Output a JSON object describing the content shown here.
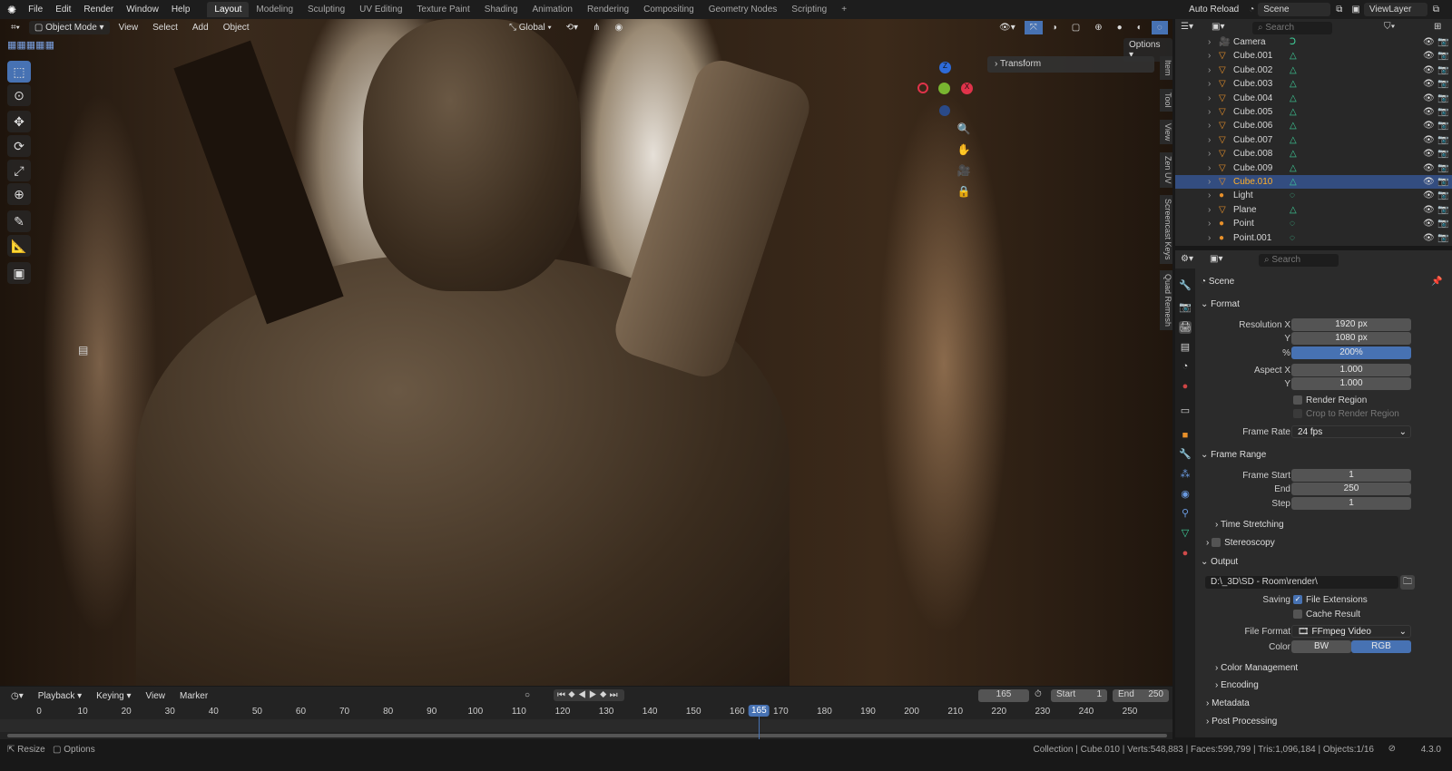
{
  "menu": [
    "File",
    "Edit",
    "Render",
    "Window",
    "Help"
  ],
  "workspaces": [
    "Layout",
    "Modeling",
    "Sculpting",
    "UV Editing",
    "Texture Paint",
    "Shading",
    "Animation",
    "Rendering",
    "Compositing",
    "Geometry Nodes",
    "Scripting"
  ],
  "topright": {
    "auto_reload": "Auto Reload",
    "scene": "Scene",
    "view_layer": "ViewLayer"
  },
  "viewport_header": {
    "mode": "Object Mode",
    "menus": [
      "View",
      "Select",
      "Add",
      "Object"
    ],
    "orientation": "Global",
    "options": "Options"
  },
  "npanel": {
    "transform": "Transform",
    "tabs": [
      "Item",
      "Tool",
      "View",
      "Zen UV",
      "Screencast Keys",
      "Quad Remesh"
    ]
  },
  "gizmo": {
    "z": "Z",
    "x": "X"
  },
  "outliner": {
    "search_placeholder": "Search",
    "items": [
      {
        "name": "Camera",
        "type": "camera"
      },
      {
        "name": "Cube.001",
        "type": "mesh"
      },
      {
        "name": "Cube.002",
        "type": "mesh"
      },
      {
        "name": "Cube.003",
        "type": "mesh"
      },
      {
        "name": "Cube.004",
        "type": "mesh"
      },
      {
        "name": "Cube.005",
        "type": "mesh"
      },
      {
        "name": "Cube.006",
        "type": "mesh"
      },
      {
        "name": "Cube.007",
        "type": "mesh"
      },
      {
        "name": "Cube.008",
        "type": "mesh"
      },
      {
        "name": "Cube.009",
        "type": "mesh"
      },
      {
        "name": "Cube.010",
        "type": "mesh",
        "selected": true
      },
      {
        "name": "Light",
        "type": "light"
      },
      {
        "name": "Plane",
        "type": "mesh"
      },
      {
        "name": "Point",
        "type": "light"
      },
      {
        "name": "Point.001",
        "type": "light"
      }
    ]
  },
  "properties": {
    "search_placeholder": "Search",
    "context": "Scene",
    "format": {
      "title": "Format",
      "res_x_label": "Resolution X",
      "res_x": "1920 px",
      "res_y_label": "Y",
      "res_y": "1080 px",
      "pct_label": "%",
      "pct": "200%",
      "aspect_x_label": "Aspect X",
      "aspect_x": "1.000",
      "aspect_y_label": "Y",
      "aspect_y": "1.000",
      "render_region": "Render Region",
      "crop": "Crop to Render Region",
      "frame_rate_label": "Frame Rate",
      "frame_rate": "24 fps"
    },
    "frame_range": {
      "title": "Frame Range",
      "start_label": "Frame Start",
      "start": "1",
      "end_label": "End",
      "end": "250",
      "step_label": "Step",
      "step": "1",
      "time_stretching": "Time Stretching"
    },
    "stereoscopy": "Stereoscopy",
    "output": {
      "title": "Output",
      "path": "D:\\_3D\\SD - Room\\render\\",
      "saving_label": "Saving",
      "file_ext": "File Extensions",
      "cache": "Cache Result",
      "format_label": "File Format",
      "format": "FFmpeg Video",
      "color_label": "Color",
      "bw": "BW",
      "rgb": "RGB",
      "color_mgmt": "Color Management",
      "encoding": "Encoding"
    },
    "metadata": "Metadata",
    "post": "Post Processing"
  },
  "timeline": {
    "menus": [
      "Playback",
      "Keying",
      "View",
      "Marker"
    ],
    "current": "165",
    "start_label": "Start",
    "start": "1",
    "end_label": "End",
    "end": "250",
    "ticks": [
      "0",
      "10",
      "20",
      "30",
      "40",
      "50",
      "60",
      "70",
      "80",
      "90",
      "100",
      "110",
      "120",
      "130",
      "140",
      "150",
      "160",
      "170",
      "180",
      "190",
      "200",
      "210",
      "220",
      "230",
      "240",
      "250"
    ],
    "current_frame": 165
  },
  "status": {
    "resize": "Resize",
    "options": "Options",
    "info": "Collection | Cube.010 | Verts:548,883 | Faces:599,799 | Tris:1,096,184 | Objects:1/16",
    "version": "4.3.0"
  }
}
